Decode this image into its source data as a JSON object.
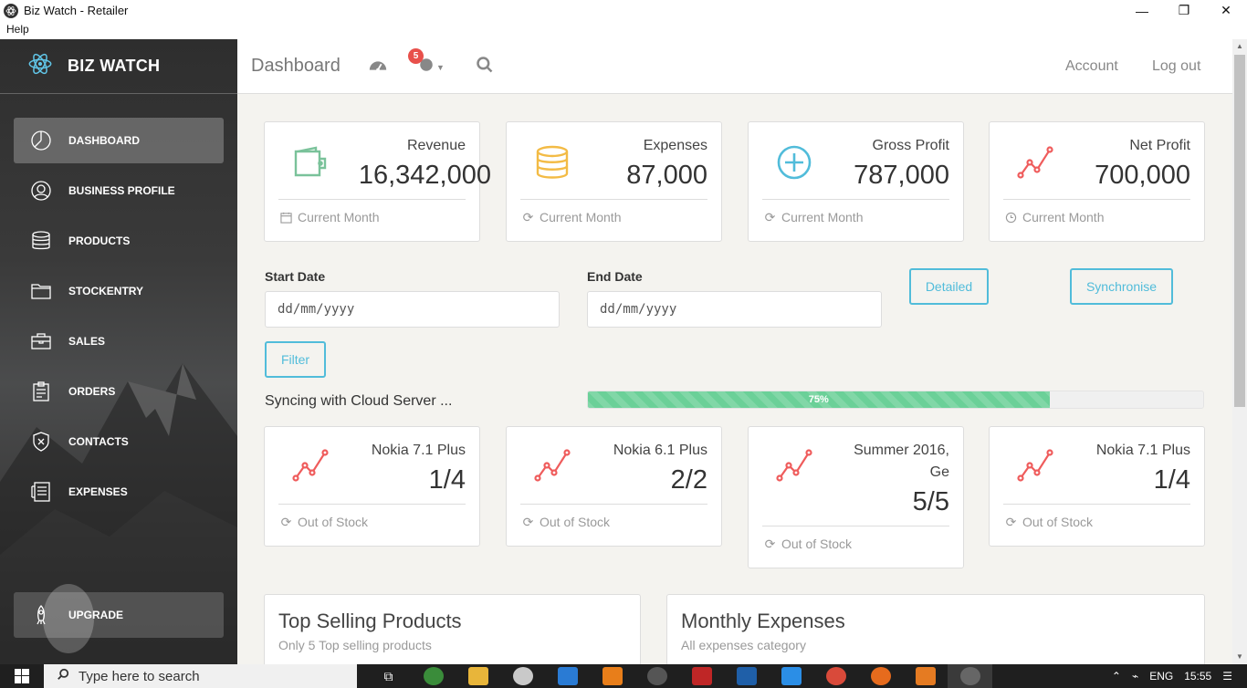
{
  "window": {
    "title": "Biz Watch - Retailer",
    "controls": [
      "minimize",
      "restore",
      "close"
    ]
  },
  "menubar": {
    "help": "Help"
  },
  "sidebar": {
    "brand": "BIZ WATCH",
    "items": [
      {
        "label": "DASHBOARD",
        "icon": "pie-chart-icon",
        "active": true
      },
      {
        "label": "BUSINESS PROFILE",
        "icon": "user-circle-icon"
      },
      {
        "label": "PRODUCTS",
        "icon": "database-icon"
      },
      {
        "label": "STOCKENTRY",
        "icon": "folder-icon"
      },
      {
        "label": "SALES",
        "icon": "briefcase-icon"
      },
      {
        "label": "ORDERS",
        "icon": "clipboard-icon"
      },
      {
        "label": "CONTACTS",
        "icon": "shield-icon"
      },
      {
        "label": "EXPENSES",
        "icon": "receipt-icon"
      }
    ],
    "upgrade": "UPGRADE"
  },
  "topnav": {
    "title": "Dashboard",
    "notification_count": "5",
    "account": "Account",
    "logout": "Log out"
  },
  "stats": [
    {
      "label": "Revenue",
      "value": "16,342,000",
      "footer": "Current Month",
      "icon": "wallet-icon",
      "footer_icon": "calendar-icon",
      "color": "#7ac29a"
    },
    {
      "label": "Expenses",
      "value": "87,000",
      "footer": "Current Month",
      "icon": "coins-icon",
      "footer_icon": "refresh-icon",
      "color": "#f3bb45"
    },
    {
      "label": "Gross Profit",
      "value": "787,000",
      "footer": "Current Month",
      "icon": "plus-circle-icon",
      "footer_icon": "refresh-icon",
      "color": "#51bcda"
    },
    {
      "label": "Net Profit",
      "value": "700,000",
      "footer": "Current Month",
      "icon": "trend-icon",
      "footer_icon": "clock-icon",
      "color": "#eb5e28"
    }
  ],
  "filters": {
    "start_label": "Start Date",
    "start_placeholder": "dd/mm/yyyy",
    "end_label": "End Date",
    "end_placeholder": "dd/mm/yyyy",
    "detailed": "Detailed",
    "synchronise": "Synchronise",
    "filter": "Filter"
  },
  "sync": {
    "text": "Syncing with Cloud Server ...",
    "percent": 75,
    "percent_label": "75%"
  },
  "stock": [
    {
      "name": "Nokia 7.1 Plus",
      "value": "1/4",
      "footer": "Out of Stock"
    },
    {
      "name": "Nokia 6.1 Plus",
      "value": "2/2",
      "footer": "Out of Stock"
    },
    {
      "name": "Summer 2016, Ge",
      "value": "5/5",
      "footer": "Out of Stock"
    },
    {
      "name": "Nokia 7.1 Plus",
      "value": "1/4",
      "footer": "Out of Stock"
    }
  ],
  "panels": {
    "top_selling": {
      "title": "Top Selling Products",
      "subtitle": "Only 5 Top selling products"
    },
    "monthly_expenses": {
      "title": "Monthly Expenses",
      "subtitle": "All expenses category"
    }
  },
  "taskbar": {
    "search_placeholder": "Type here to search",
    "lang": "ENG",
    "time": "15:55"
  }
}
